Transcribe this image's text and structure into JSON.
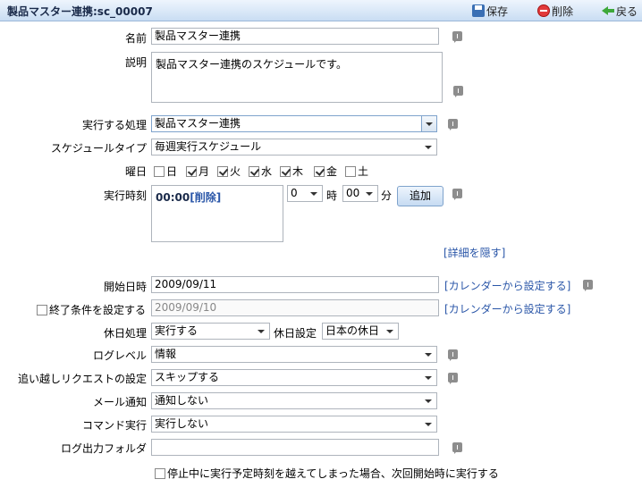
{
  "window": {
    "title": "製品マスター連携:sc_00007",
    "save_label": "保存",
    "delete_label": "削除",
    "back_label": "戻る"
  },
  "form": {
    "name_label": "名前",
    "name_value": "製品マスター連携",
    "description_label": "説明",
    "description_value": "製品マスター連携のスケジュールです。",
    "process_label": "実行する処理",
    "process_value": "製品マスター連携",
    "schedule_type_label": "スケジュールタイプ",
    "schedule_type_value": "毎週実行スケジュール",
    "weekday_label": "曜日",
    "weekdays": [
      {
        "label": "日",
        "checked": false
      },
      {
        "label": "月",
        "checked": true
      },
      {
        "label": "火",
        "checked": true
      },
      {
        "label": "水",
        "checked": true
      },
      {
        "label": "木",
        "checked": true
      },
      {
        "label": "金",
        "checked": true
      },
      {
        "label": "土",
        "checked": false
      }
    ],
    "time_label": "実行時刻",
    "time_entries": [
      {
        "time": "00:00",
        "delete": "[削除]"
      }
    ],
    "hour_value": "0",
    "hour_unit": "時",
    "minute_value": "00",
    "minute_unit": "分",
    "add_button": "追加",
    "hide_details_link": "[詳細を隠す]",
    "start_label": "開始日時",
    "start_value": "2009/09/11",
    "calendar_link": "[カレンダーから設定する]",
    "end_condition_label": "終了条件を設定する",
    "end_condition_checked": false,
    "end_value": "2009/09/10",
    "holiday_process_label": "休日処理",
    "holiday_process_value": "実行する",
    "holiday_setting_label": "休日設定",
    "holiday_setting_value": "日本の休日",
    "log_level_label": "ログレベル",
    "log_level_value": "情報",
    "overtake_label": "追い越しリクエストの設定",
    "overtake_value": "スキップする",
    "mail_label": "メール通知",
    "mail_value": "通知しない",
    "command_label": "コマンド実行",
    "command_value": "実行しない",
    "log_folder_label": "ログ出力フォルダ",
    "log_folder_value": "",
    "catchup_label": "停止中に実行予定時刻を越えてしまった場合、次回開始時に実行する",
    "catchup_checked": false
  }
}
